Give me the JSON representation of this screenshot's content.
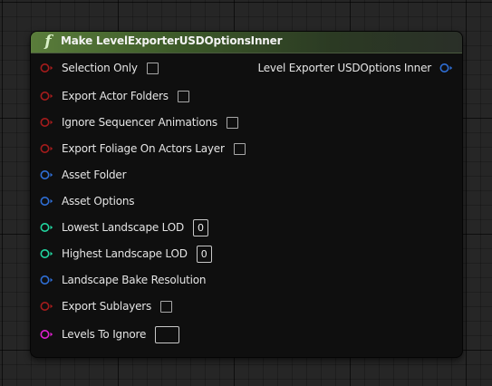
{
  "node": {
    "title": "Make LevelExporterUSDOptionsInner",
    "icon": "function-icon",
    "icon_glyph": "f",
    "header_color": "#5a7d3b"
  },
  "output": {
    "label": "Level Exporter USDOptions Inner",
    "type": "struct",
    "color": "#2f6fd6"
  },
  "inputs": [
    {
      "label": "Selection Only",
      "type": "bool",
      "color": "#a61c1c",
      "checked": false
    },
    {
      "label": "Export Actor Folders",
      "type": "bool",
      "color": "#a61c1c",
      "checked": false
    },
    {
      "label": "Ignore Sequencer Animations",
      "type": "bool",
      "color": "#a61c1c",
      "checked": false
    },
    {
      "label": "Export Foliage On Actors Layer",
      "type": "bool",
      "color": "#a61c1c",
      "checked": false
    },
    {
      "label": "Asset Folder",
      "type": "struct",
      "color": "#2f6fd6"
    },
    {
      "label": "Asset Options",
      "type": "struct",
      "color": "#2f6fd6"
    },
    {
      "label": "Lowest Landscape LOD",
      "type": "int",
      "color": "#22d6a0",
      "value": "0"
    },
    {
      "label": "Highest Landscape LOD",
      "type": "int",
      "color": "#22d6a0",
      "value": "0"
    },
    {
      "label": "Landscape Bake Resolution",
      "type": "struct",
      "color": "#2f6fd6"
    },
    {
      "label": "Export Sublayers",
      "type": "bool",
      "color": "#a61c1c",
      "checked": false
    },
    {
      "label": "Levels To Ignore",
      "type": "set",
      "color": "#e020d0",
      "value": ""
    }
  ]
}
